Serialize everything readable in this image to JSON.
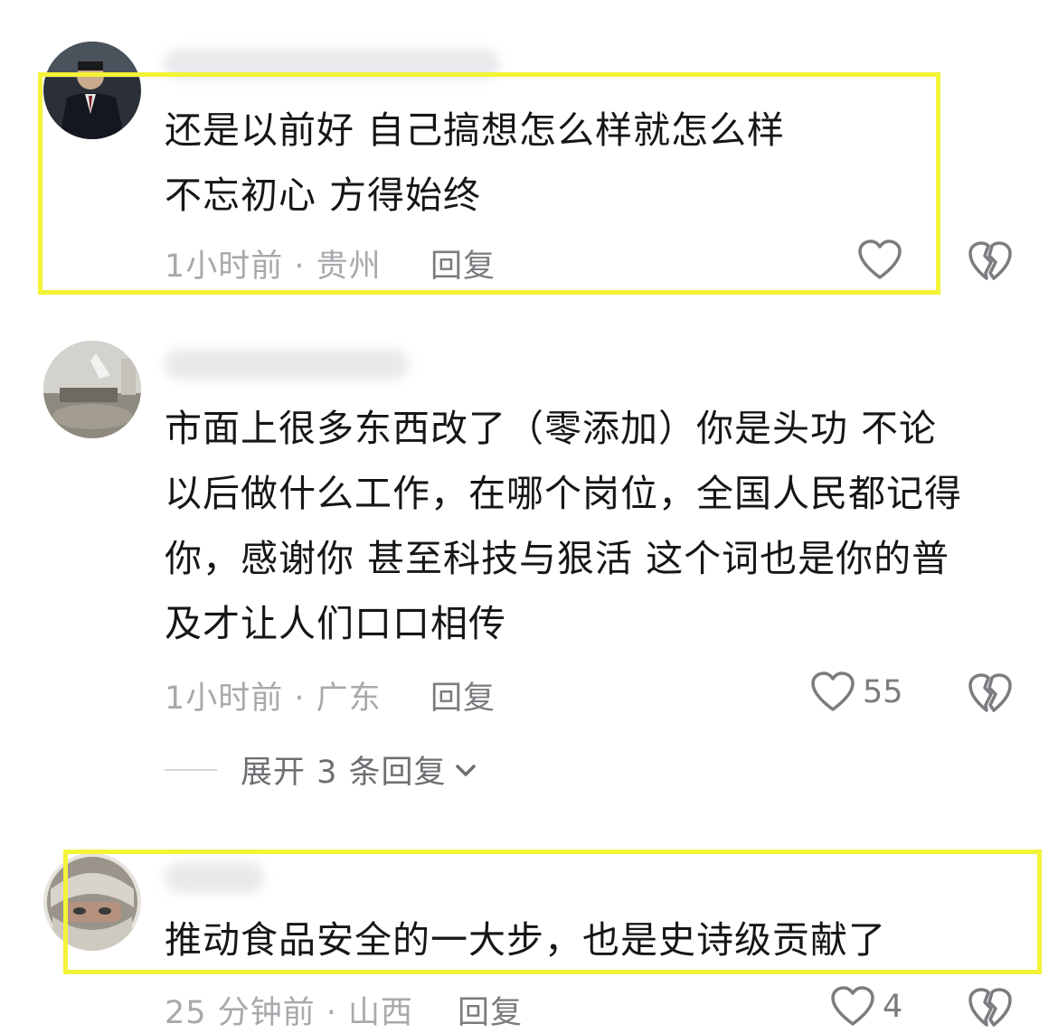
{
  "comments": [
    {
      "text": "还是以前好 自己搞想怎么样就怎么样\n不忘初心 方得始终",
      "meta": "1小时前 · 贵州",
      "reply_label": "回复",
      "like_count": "",
      "highlighted": true
    },
    {
      "text": "市面上很多东西改了（零添加）你是头功  不论\n以后做什么工作，在哪个岗位，全国人民都记得\n你，感谢你  甚至科技与狠活 这个词也是你的普\n及才让人们口口相传",
      "meta": "1小时前 · 广东",
      "reply_label": "回复",
      "like_count": "55",
      "expand_label": "展开 3 条回复",
      "highlighted": false
    },
    {
      "text": "推动食品安全的一大步，也是史诗级贡献了",
      "meta": "25 分钟前 · 山西",
      "reply_label": "回复",
      "like_count": "4",
      "highlighted": true
    }
  ],
  "icons": {
    "like": "heart-outline-icon",
    "dislike": "broken-heart-icon",
    "expand": "chevron-down-icon"
  },
  "colors": {
    "highlight": "#f3f338",
    "meta_text": "#a8a8ad",
    "action_text": "#7b7b80"
  }
}
